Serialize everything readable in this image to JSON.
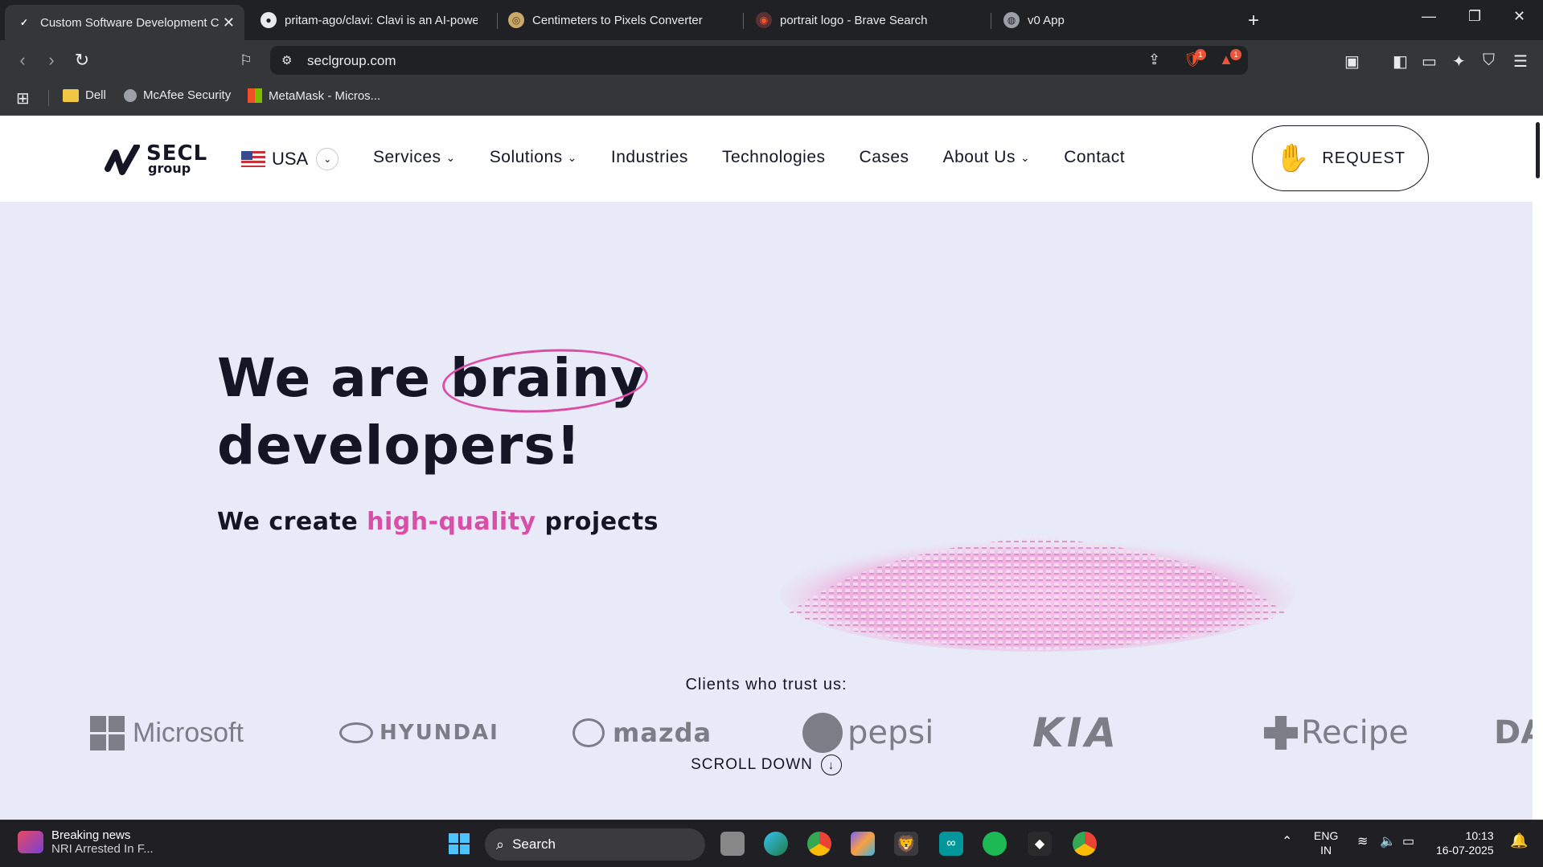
{
  "browser": {
    "tabs": [
      {
        "label": "Custom Software Development C",
        "active": true,
        "icon": "secl-favicon"
      },
      {
        "label": "pritam-ago/clavi: Clavi is an AI-powe",
        "active": false,
        "icon": "github-icon"
      },
      {
        "label": "Centimeters to Pixels Converter",
        "active": false,
        "icon": "converter-favicon"
      },
      {
        "label": "portrait logo - Brave Search",
        "active": false,
        "icon": "brave-search-icon"
      },
      {
        "label": "v0 App",
        "active": false,
        "icon": "globe-icon"
      }
    ],
    "url": "seclgroup.com",
    "brave_badge": "1",
    "rewards_badge": "1",
    "bookmarks": [
      {
        "label": "Dell",
        "icon": "folder-icon"
      },
      {
        "label": "McAfee Security",
        "icon": "globe-icon"
      },
      {
        "label": "MetaMask - Micros...",
        "icon": "microsoft-icon"
      }
    ]
  },
  "site": {
    "logo": {
      "line1": "SECL",
      "line2": "group"
    },
    "region": "USA",
    "nav": [
      {
        "label": "Services",
        "dropdown": true
      },
      {
        "label": "Solutions",
        "dropdown": true
      },
      {
        "label": "Industries",
        "dropdown": false
      },
      {
        "label": "Technologies",
        "dropdown": false
      },
      {
        "label": "Cases",
        "dropdown": false
      },
      {
        "label": "About Us",
        "dropdown": true
      },
      {
        "label": "Contact",
        "dropdown": false
      }
    ],
    "request_label": "REQUEST",
    "hero": {
      "title_pre": "We are ",
      "title_highlight": "brainy",
      "title_line2": "developers!",
      "sub_pre": "We create ",
      "sub_accent": "high-quality",
      "sub_post": " projects"
    },
    "clients_label": "Clients who trust us:",
    "clients": [
      "Microsoft",
      "HYUNDAI",
      "mazda",
      "pepsi",
      "KIA",
      "Recipe",
      "DA"
    ],
    "scroll_down": "SCROLL DOWN",
    "colors": {
      "accent": "#d94fa7",
      "text": "#141625",
      "hero_bg": "#e8ebf7"
    }
  },
  "taskbar": {
    "news_title": "Breaking news",
    "news_sub": "NRI Arrested In F...",
    "search_label": "Search",
    "lang_line1": "ENG",
    "lang_line2": "IN",
    "time": "10:13",
    "date": "16-07-2025"
  }
}
